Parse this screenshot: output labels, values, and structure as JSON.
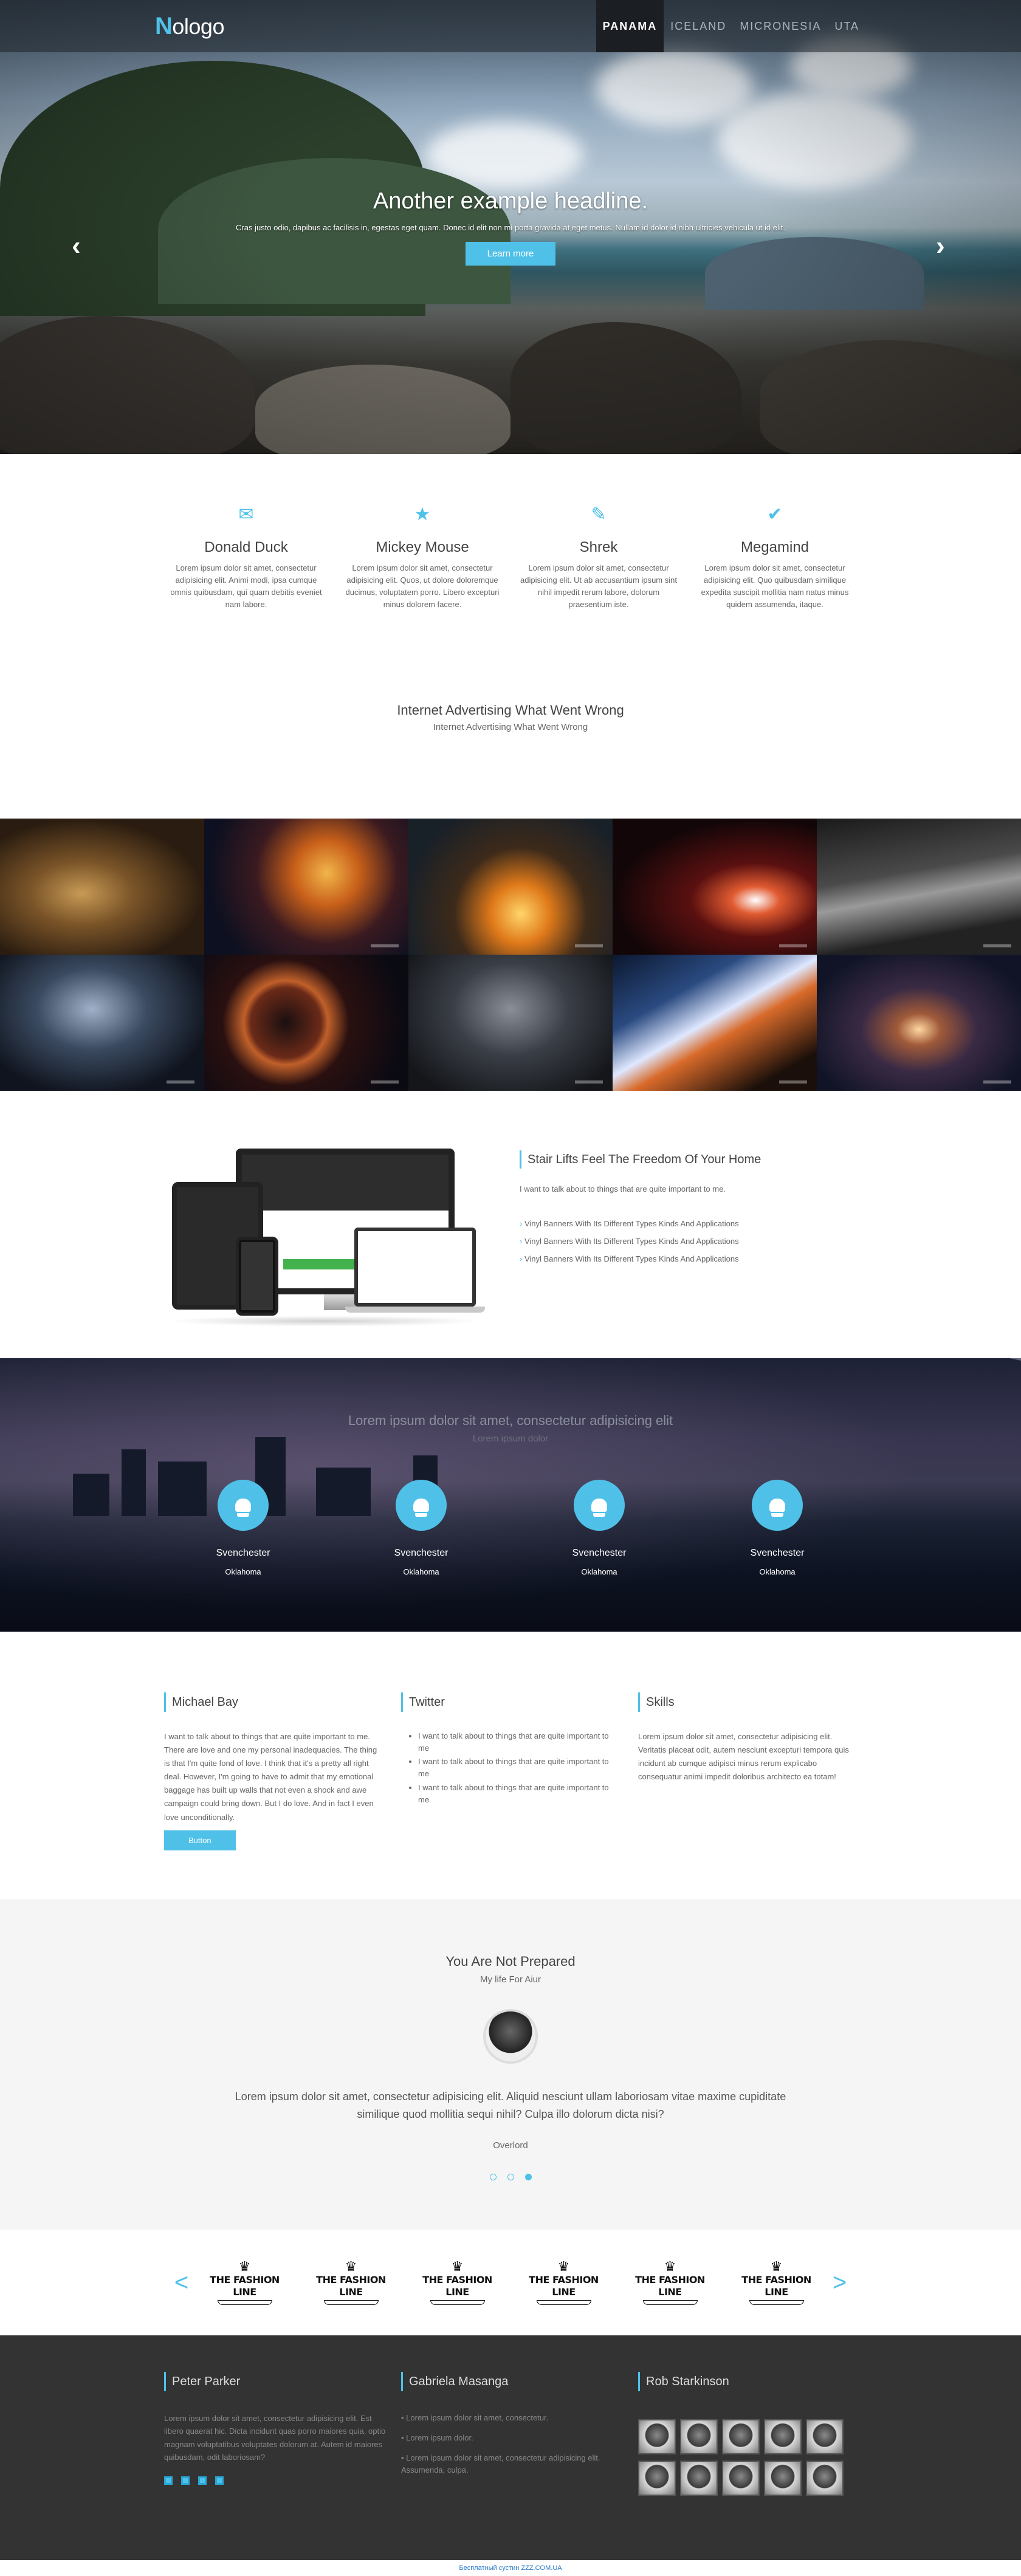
{
  "brand": {
    "first": "N",
    "rest": "ologo"
  },
  "nav": [
    "PANAMA",
    "ICELAND",
    "MICRONESIA",
    "UTA"
  ],
  "hero": {
    "headline": "Another example headline.",
    "text": "Cras justo odio, dapibus ac facilisis in, egestas eget quam. Donec id elit non mi porta gravida at eget metus. Nullam id dolor id nibh ultricies vehicula ut id elit.",
    "button": "Learn more",
    "prev": "‹",
    "next": "›"
  },
  "features": [
    {
      "icon": "envelope-icon",
      "glyph": "✉",
      "title": "Donald Duck",
      "text": "Lorem ipsum dolor sit amet, consectetur adipisicing elit. Animi modi, ipsa cumque omnis quibusdam, qui quam debitis eveniet nam labore."
    },
    {
      "icon": "star-icon",
      "glyph": "★",
      "title": "Mickey Mouse",
      "text": "Lorem ipsum dolor sit amet, consectetur adipisicing elit. Quos, ut dolore doloremque ducimus, voluptatem porro. Libero excepturi minus dolorem facere."
    },
    {
      "icon": "pencil-icon",
      "glyph": "✎",
      "title": "Shrek",
      "text": "Lorem ipsum dolor sit amet, consectetur adipisicing elit. Ut ab accusantium ipsum sint nihil impedit rerum labore, dolorum praesentium iste."
    },
    {
      "icon": "check-icon",
      "glyph": "✔",
      "title": "Megamind",
      "text": "Lorem ipsum dolor sit amet, consectetur adipisicing elit. Quo quibusdam similique expedita suscipit mollitia nam natus minus quidem assumenda, itaque."
    }
  ],
  "intro": {
    "title": "Internet Advertising What Went Wrong",
    "subtitle": "Internet Advertising What Went Wrong"
  },
  "devices": {
    "title": "Stair Lifts Feel The Freedom Of Your Home",
    "lead": "I want to talk about to things that are quite important to me.",
    "items": [
      "Vinyl Banners With Its Different Types Kinds And Applications",
      "Vinyl Banners With Its Different Types Kinds And Applications",
      "Vinyl Banners With Its Different Types Kinds And Applications"
    ]
  },
  "city": {
    "title": "Lorem ipsum dolor sit amet, consectetur adipisicing elit",
    "subtitle": "Lorem ipsum dolor",
    "stats": [
      {
        "icon": "android-icon",
        "title": "Svenchester",
        "sub": "Oklahoma"
      },
      {
        "icon": "android-icon",
        "title": "Svenchester",
        "sub": "Oklahoma"
      },
      {
        "icon": "android-icon",
        "title": "Svenchester",
        "sub": "Oklahoma"
      },
      {
        "icon": "android-icon",
        "title": "Svenchester",
        "sub": "Oklahoma"
      }
    ]
  },
  "info": {
    "col1": {
      "title": "Michael Bay",
      "text": "I want to talk about to things that are quite important to me. There are love and one my personal inadequacies. The thing is that I'm quite fond of love. I think that it's a pretty all right deal. However, I'm going to have to admit that my emotional baggage has built up walls that not even a shock and awe campaign could bring down. But I do love. And in fact I even love unconditionally.",
      "button": "Button"
    },
    "col2": {
      "title": "Twitter",
      "items": [
        "I want to talk about to things that are quite important to me",
        "I want to talk about to things that are quite important to me",
        "I want to talk about to things that are quite important to me"
      ]
    },
    "col3": {
      "title": "Skills",
      "text": "Lorem ipsum dolor sit amet, consectetur adipisicing elit. Veritatis placeat odit, autem nesciunt excepturi tempora quis incidunt ab cumque adipisci minus rerum explicabo consequatur animi impedit doloribus architecto ea totam!"
    }
  },
  "testimonial": {
    "title": "You Are Not Prepared",
    "subtitle": "My life For Aiur",
    "quote": "Lorem ipsum dolor sit amet, consectetur adipisicing elit. Aliquid nesciunt ullam laboriosam vitae maxime cupiditate similique quod mollitia sequi nihil? Culpa illo dolorum dicta nisi?",
    "author": "Overlord"
  },
  "clients": {
    "prev": "<",
    "next": ">",
    "logos": [
      "THE FASHION LINE",
      "THE FASHION LINE",
      "THE FASHION LINE",
      "THE FASHION LINE",
      "THE FASHION LINE",
      "THE FASHION LINE"
    ]
  },
  "footer": {
    "col1": {
      "title": "Peter Parker",
      "text": "Lorem ipsum dolor sit amet, consectetur adipisicing elit. Est libero quaerat hic. Dicta incidunt quas porro maiores quia, optio magnam voluptatibus voluptates dolorum at. Autem id maiores quibusdam, odit laboriosam?"
    },
    "col2": {
      "title": "Gabriela Masanga",
      "items": [
        "Lorem ipsum dolor sit amet, consectetur.",
        "Lorem ipsum dolor.",
        "Lorem ipsum dolor sit amet, consectetur adipisicing elit. Assumenda, culpa."
      ]
    },
    "col3": {
      "title": "Rob Starkinson"
    }
  },
  "copyright": "Бесплатный сустин ZZZ.COM.UA",
  "colors": {
    "accent": "#4fc1e9",
    "footer": "#333333"
  }
}
